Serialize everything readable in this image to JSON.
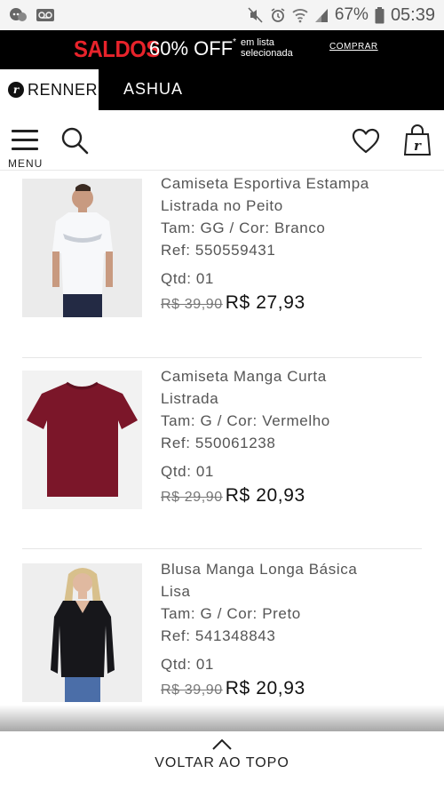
{
  "status_bar": {
    "battery_percent": "67%",
    "time": "05:39"
  },
  "promo": {
    "saldos": "SALDOS",
    "off": "60% OFF",
    "asterisk": "*",
    "list_text": "em lista selecionada",
    "cta": "COMPRAR",
    "accent_color": "#e8232b"
  },
  "brands": {
    "renner": "RENNER",
    "ashua": "ASHUA"
  },
  "header": {
    "menu_label": "MENU"
  },
  "products": [
    {
      "name": "Camiseta Esportiva Estampa Listrada no Peito",
      "size_color": "Tam: GG  /  Cor: Branco",
      "ref": "Ref: 550559431",
      "qty": "Qtd: 01",
      "old_price": "R$ 39,90",
      "new_price": "R$ 27,93"
    },
    {
      "name": "Camiseta Manga Curta Listrada",
      "size_color": "Tam: G  /  Cor: Vermelho",
      "ref": "Ref: 550061238",
      "qty": "Qtd: 01",
      "old_price": "R$ 29,90",
      "new_price": "R$ 20,93"
    },
    {
      "name": "Blusa Manga Longa Básica Lisa",
      "size_color": "Tam: G  /  Cor: Preto",
      "ref": "Ref: 541348843",
      "qty": "Qtd: 01",
      "old_price": "R$ 39,90",
      "new_price": "R$ 20,93"
    }
  ],
  "footer": {
    "back_to_top": "VOLTAR AO TOPO"
  }
}
